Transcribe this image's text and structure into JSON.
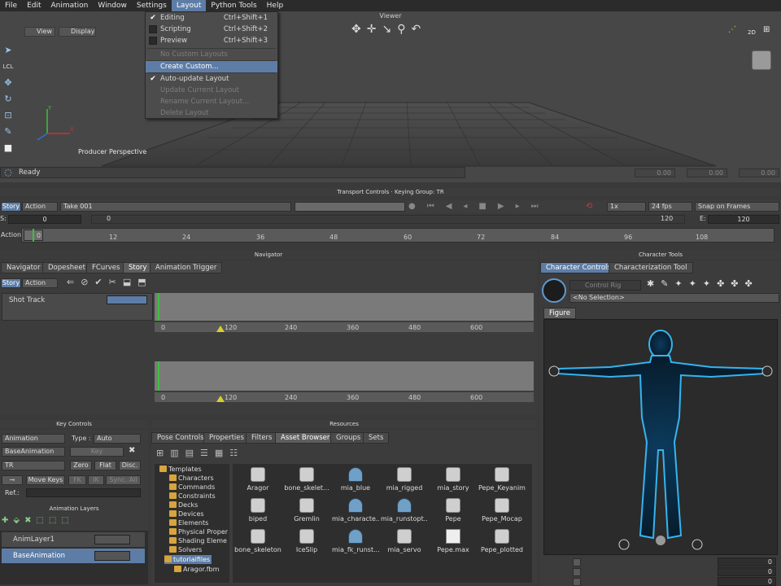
{
  "menubar": {
    "items": [
      "File",
      "Edit",
      "Animation",
      "Window",
      "Settings",
      "Layout",
      "Python Tools",
      "Help"
    ],
    "active": "Layout"
  },
  "layout_menu": {
    "items": [
      {
        "label": "Editing",
        "shortcut": "Ctrl+Shift+1",
        "checked": true
      },
      {
        "label": "Scripting",
        "shortcut": "Ctrl+Shift+2"
      },
      {
        "label": "Preview",
        "shortcut": "Ctrl+Shift+3"
      },
      {
        "label": "No Custom Layouts",
        "disabled": true
      },
      {
        "label": "Create Custom...",
        "highlighted": true
      },
      {
        "label": "Auto-update Layout",
        "checked": true
      },
      {
        "label": "Update Current Layout",
        "disabled": true
      },
      {
        "label": "Rename Current Layout...",
        "disabled": true
      },
      {
        "label": "Delete Layout",
        "disabled": true
      }
    ]
  },
  "viewer": {
    "title": "Viewer",
    "view_btn": "View",
    "display_btn": "Display",
    "perspective": "Producer Perspective",
    "status": "Ready",
    "coords": [
      "0.00",
      "0.00",
      "0.00"
    ],
    "axis_x": "X",
    "axis_y": "Y",
    "lcl": "LCL",
    "right_btn": "2D"
  },
  "transport": {
    "title": "Transport Controls  ·  Keying Group: TR",
    "mode": "Story",
    "action": "Action",
    "take": "Take 001",
    "speed": "1x",
    "fps": "24 fps",
    "snap": "Snap on Frames",
    "start_label": "S:",
    "start_val": "0",
    "cur_val": "0",
    "cur_end": "120",
    "end_label": "E:",
    "end_val": "120",
    "action_label": "Action",
    "ruler": [
      "12",
      "24",
      "36",
      "48",
      "60",
      "72",
      "84",
      "96",
      "108"
    ],
    "ruler_cur": "0"
  },
  "navigator": {
    "title": "Navigator",
    "tabs": [
      "Navigator",
      "Dopesheet",
      "FCurves",
      "Story",
      "Animation Trigger"
    ],
    "active_tab": "Story",
    "mode": "Story",
    "action": "Action",
    "track": "Shot Track",
    "ruler": [
      "120",
      "240",
      "360",
      "480",
      "600"
    ],
    "ruler_start": "0"
  },
  "key_controls": {
    "title": "Key Controls",
    "animation": "Animation",
    "type_label": "Type :",
    "type_val": "Auto",
    "base": "BaseAnimation",
    "key": "Key",
    "tr": "TR",
    "zero": "Zero",
    "flat": "Flat",
    "disc": "Disc.",
    "move_keys": "Move Keys",
    "fk": "FK",
    "ik": "IK",
    "sync": "Sync. All",
    "ref": "Ref.:"
  },
  "anim_layers": {
    "title": "Animation Layers",
    "layers": [
      "AnimLayer1",
      "BaseAnimation"
    ]
  },
  "resources": {
    "title": "Resources",
    "tabs": [
      "Pose Controls",
      "Properties",
      "Filters",
      "Asset Browser",
      "Groups",
      "Sets"
    ],
    "active_tab": "Asset Browser",
    "tree": [
      "Templates",
      "Characters",
      "Commands",
      "Constraints",
      "Decks",
      "Devices",
      "Elements",
      "Physical Proper",
      "Shading Eleme",
      "Solvers",
      "tutorialfiles",
      "Aragor.fbm"
    ],
    "assets": [
      [
        "Aragor",
        "bone_skelet...",
        "mia_blue",
        "mia_rigged",
        "mia_story",
        "Pepe_Keyanim"
      ],
      [
        "biped",
        "Gremlin",
        "mia_characte...",
        "mia_runstopt...",
        "Pepe",
        "Pepe_Mocap"
      ],
      [
        "bone_skeleton",
        "IceSlip",
        "mia_fk_runst...",
        "mia_servo",
        "Pepe.max",
        "Pepe_plotted"
      ]
    ]
  },
  "character_tools": {
    "title": "Character Tools",
    "tabs": [
      "Character Controls",
      "Characterization Tool"
    ],
    "active_tab": "Character Controls",
    "control_rig": "Control Rig",
    "selection": "<No Selection>",
    "figure_tab": "Figure",
    "fields": [
      "0",
      "0",
      "0"
    ]
  }
}
